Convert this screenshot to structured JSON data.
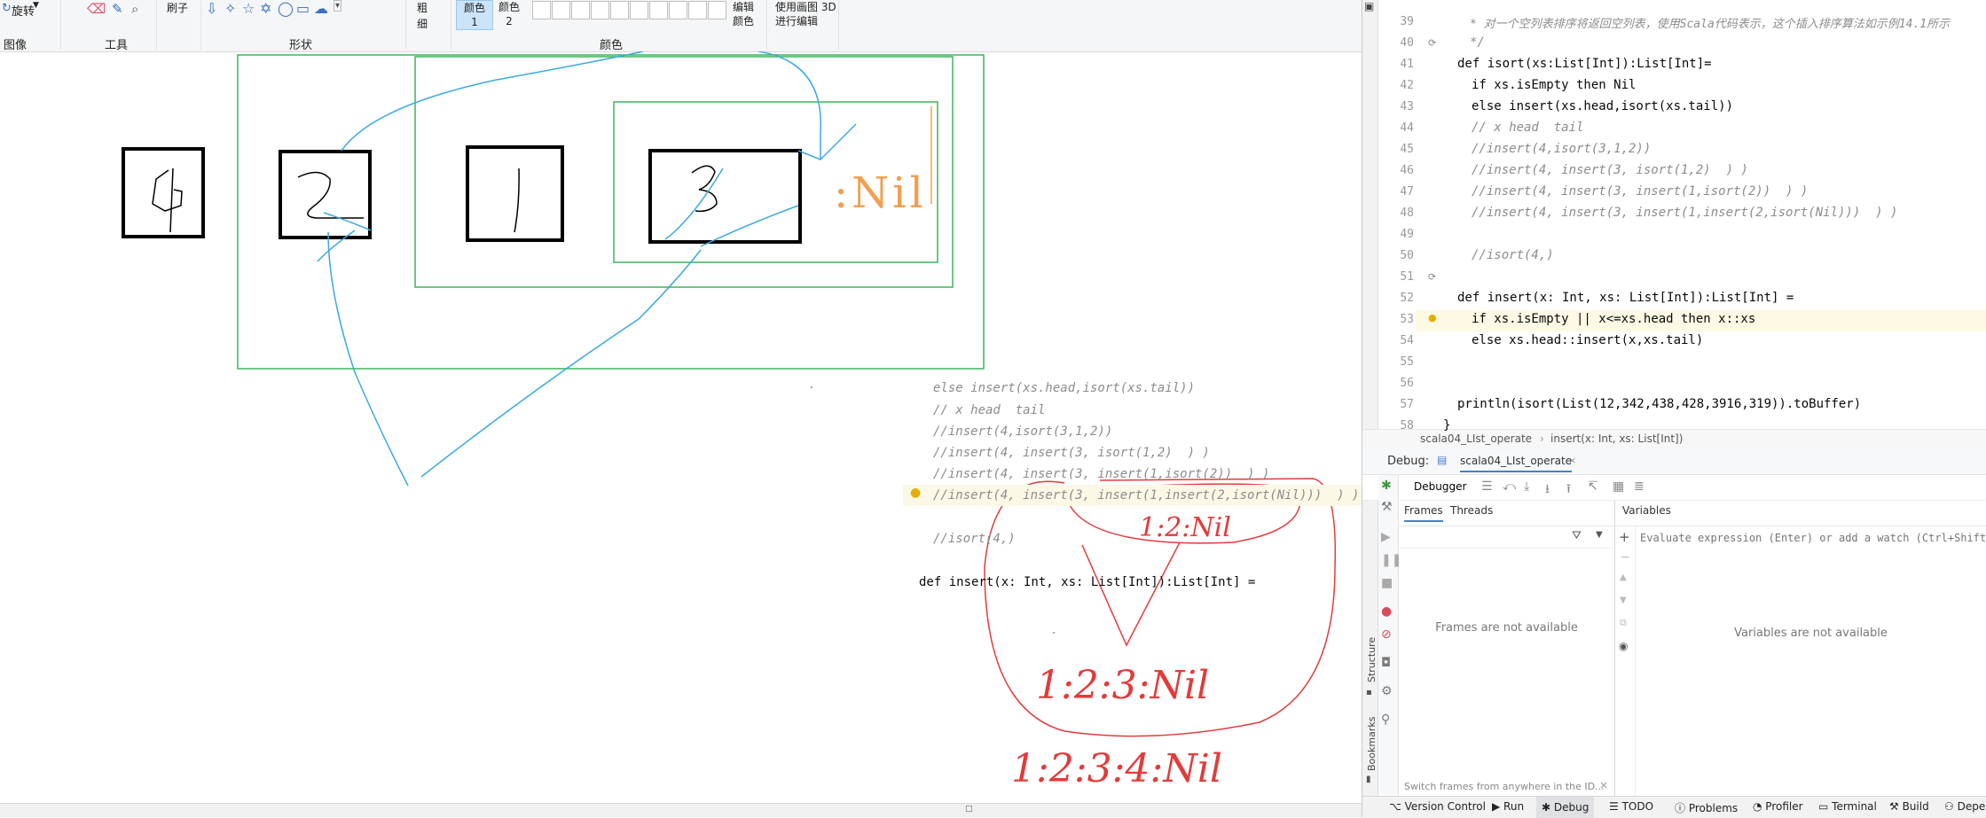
{
  "paint": {
    "ribbon": {
      "rotate_label": "旋转",
      "brush_label": "刷子",
      "shapes_partial": "形状",
      "size_label": "粗细",
      "color1_label": "颜色 1",
      "color2_label": "颜色 2",
      "edit_colors_label": "编辑颜色",
      "paint3d_label": "使用画图 3D 进行编辑",
      "group_image": "图像",
      "group_tools": "工具",
      "group_shapes": "形状",
      "group_colors": "颜色"
    },
    "drawing": {
      "box_digits": [
        "4",
        "2",
        "1",
        "3"
      ],
      "nil_label": ":Nil",
      "result_inner": "1:2:Nil",
      "result_middle": "1:2:3:Nil",
      "result_final": "1:2:3:4:Nil"
    },
    "pasted_code": {
      "lines": [
        "else insert(xs.head,isort(xs.tail))",
        "// x head  tail",
        "//insert(4,isort(3,1,2))",
        "//insert(4, insert(3, isort(1,2)  ) )",
        "//insert(4, insert(3, insert(1,isort(2))  ) )",
        "//insert(4, insert(3, insert(1,insert(2,isort(Nil)))  ) )",
        "//isort(4,)",
        "def insert(x: Int, xs: List[Int]):List[Int] ="
      ]
    }
  },
  "ide": {
    "editor": {
      "line_numbers": [
        "39",
        "40",
        "41",
        "42",
        "43",
        "44",
        "45",
        "46",
        "47",
        "48",
        "49",
        "50",
        "51",
        "52",
        "53",
        "54",
        "55",
        "56",
        "57",
        "58"
      ],
      "lines": [
        "* 对一个空列表排序将返回空列表，使用Scala代码表示，这个插入排序算法如示例14.1所示",
        "*/",
        "def isort(xs:List[Int]):List[Int]=",
        "if xs.isEmpty then Nil",
        "else insert(xs.head,isort(xs.tail))",
        "// x head  tail",
        "//insert(4,isort(3,1,2))",
        "//insert(4, insert(3, isort(1,2)  ) )",
        "//insert(4, insert(3, insert(1,isort(2))  ) )",
        "//insert(4, insert(3, insert(1,insert(2,isort(Nil)))  ) )",
        "",
        "//isort(4,)",
        "",
        "def insert(x: Int, xs: List[Int]):List[Int] =",
        "if xs.isEmpty || x<=xs.head then x::xs",
        "else xs.head::insert(x,xs.tail)",
        "",
        "",
        "println(isort(List(12,342,438,428,3916,319)).toBuffer)",
        "}"
      ]
    },
    "breadcrumb": [
      "scala04_LIst_operate",
      "insert(x: Int, xs: List[Int])"
    ],
    "debug": {
      "label": "Debug:",
      "tab": "scala04_LIst_operate",
      "debugger_tab": "Debugger",
      "frames_tab": "Frames",
      "threads_tab": "Threads",
      "variables_tab": "Variables",
      "frames_empty": "Frames are not available",
      "variables_empty": "Variables are not available",
      "watch_placeholder": "Evaluate expression (Enter) or add a watch (Ctrl+Shift+Enter)",
      "switch_hint": "Switch frames from anywhere in the ID..."
    },
    "side_labels": [
      "Structure",
      "Bookmarks"
    ],
    "bottom_tabs": [
      "Version Control",
      "Run",
      "Debug",
      "TODO",
      "Problems",
      "Profiler",
      "Terminal",
      "Build",
      "Dependencies"
    ]
  }
}
